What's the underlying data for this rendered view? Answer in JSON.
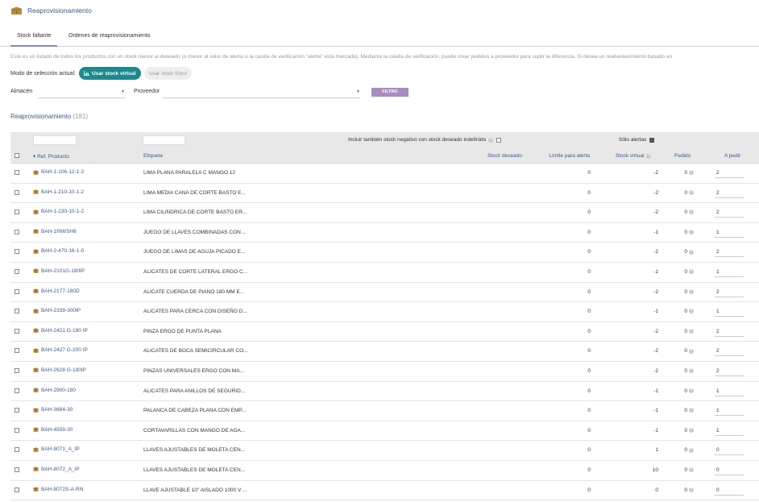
{
  "header": {
    "title": "Reaprovisionamiento",
    "icon": "box-icon"
  },
  "tabs": [
    {
      "label": "Stock faltante",
      "active": true
    },
    {
      "label": "Ordenes de reaprovisionamiento",
      "active": false
    }
  ],
  "description": "Este es un listado de todos los productos con un stock menor al deseado (o menor al valor de alerta si la casilla de verificación \"alerta\" está marcada). Mediante la casilla de verificación, puede crear pedidos a proveedor para suplir la diferencia. Si desea un reabastecimiento basado en",
  "mode": {
    "label": "Modo de selección actual:",
    "virtual_button": "Usar stock virtual",
    "physical_button": "Usar stock físico"
  },
  "filters": {
    "warehouse_label": "Almacén",
    "supplier_label": "Proveedor",
    "filter_button": "FILTRO"
  },
  "section": {
    "title": "Reaprovisionamiento",
    "count": "(181)"
  },
  "table": {
    "include_negative_label": "Incluir también stock negativo con stock deseado indefinido",
    "only_alerts_label": "Sólo alertas",
    "only_alerts_checked": true,
    "columns": {
      "ref": "▾ Ref. Producto",
      "label": "Etiqueta",
      "desired": "Stock deseado",
      "limit": "Límite para alerta",
      "virtual": "Stock virtual",
      "ordered": "Pedido",
      "to_order": "A pedir"
    },
    "rows": [
      {
        "ref": "BAH-1-106-12-1-2",
        "label": "LIMA PLANA PARALELA C MANGO 12",
        "desired": "",
        "limit": "0",
        "virtual": "-2",
        "ordered": "0",
        "to_order": "2"
      },
      {
        "ref": "BAH-1-210-10-1-2",
        "label": "LIMA MEDIA CANA DE CORTE BASTO E...",
        "desired": "",
        "limit": "0",
        "virtual": "-2",
        "ordered": "0",
        "to_order": "2"
      },
      {
        "ref": "BAH-1-230-10-1-2",
        "label": "LIMA CILINDRICA DE CORTE BASTO ER...",
        "desired": "",
        "limit": "0",
        "virtual": "-2",
        "ordered": "0",
        "to_order": "2"
      },
      {
        "ref": "BAH-1RM/SH8",
        "label": "JUEGO DE LLAVES COMBINADAS CON ...",
        "desired": "",
        "limit": "0",
        "virtual": "-1",
        "ordered": "0",
        "to_order": "1"
      },
      {
        "ref": "BAH-2-470-16-1-0",
        "label": "JUEGO DE LIMAS DE AGUJA PICADO E...",
        "desired": "",
        "limit": "0",
        "virtual": "-2",
        "ordered": "0",
        "to_order": "2"
      },
      {
        "ref": "BAH-2101G-180IP",
        "label": "ALICATES DE CORTE LATERAL ERGO C...",
        "desired": "",
        "limit": "0",
        "virtual": "-1",
        "ordered": "0",
        "to_order": "1"
      },
      {
        "ref": "BAH-2177-180D",
        "label": "ALICATE CUERDA DE PIANO 180 MM E...",
        "desired": "",
        "limit": "0",
        "virtual": "-2",
        "ordered": "0",
        "to_order": "2"
      },
      {
        "ref": "BAH-2339-300IP",
        "label": "ALICATES PARA CERCA CON DISEÑO D...",
        "desired": "",
        "limit": "0",
        "virtual": "-1",
        "ordered": "0",
        "to_order": "1"
      },
      {
        "ref": "BAH-2421 G-180 IP",
        "label": "PINZA ERGO DE PUNTA PLANA",
        "desired": "",
        "limit": "0",
        "virtual": "-2",
        "ordered": "0",
        "to_order": "2"
      },
      {
        "ref": "BAH-2427 G-200 IP",
        "label": "ALICATES DE BOCA SEMICIRCULAR CO...",
        "desired": "",
        "limit": "0",
        "virtual": "-2",
        "ordered": "0",
        "to_order": "2"
      },
      {
        "ref": "BAH-2628 G-180IP",
        "label": "PINZAS UNIVERSALES ERGO CON MA...",
        "desired": "",
        "limit": "0",
        "virtual": "-2",
        "ordered": "0",
        "to_order": "2"
      },
      {
        "ref": "BAH-2900-180",
        "label": "ALICATES PARA ANILLOS DE SEGURID...",
        "desired": "",
        "limit": "0",
        "virtual": "-1",
        "ordered": "0",
        "to_order": "1"
      },
      {
        "ref": "BAH-3684-30",
        "label": "PALANCA DE CABEZA PLANA CON EMP...",
        "desired": "",
        "limit": "0",
        "virtual": "-1",
        "ordered": "0",
        "to_order": "1"
      },
      {
        "ref": "BAH-4559-30",
        "label": "CORTAVARILLAS CON MANGO DE AGA...",
        "desired": "",
        "limit": "0",
        "virtual": "-1",
        "ordered": "0",
        "to_order": "1"
      },
      {
        "ref": "BAH-8071_A_IP",
        "label": "LLAVES AJUSTABLES DE MOLETA CEN...",
        "desired": "",
        "limit": "0",
        "virtual": "1",
        "ordered": "0",
        "to_order": "0"
      },
      {
        "ref": "BAH-8072_A_IP",
        "label": "LLAVES AJUSTABLES DE MOLETA CEN...",
        "desired": "",
        "limit": "0",
        "virtual": "10",
        "ordered": "0",
        "to_order": "0"
      },
      {
        "ref": "BAH-8072S-A-RN",
        "label": "LLAVE AJUSTABLE 10\" AISLADO 1000 V ...",
        "desired": "",
        "limit": "0",
        "virtual": "0",
        "ordered": "0",
        "to_order": "0"
      }
    ]
  },
  "colors": {
    "accent": "#1a8a8f",
    "link": "#3b5a8c",
    "filter_button": "#a98cbf",
    "header_bg": "#e8e8e8"
  }
}
